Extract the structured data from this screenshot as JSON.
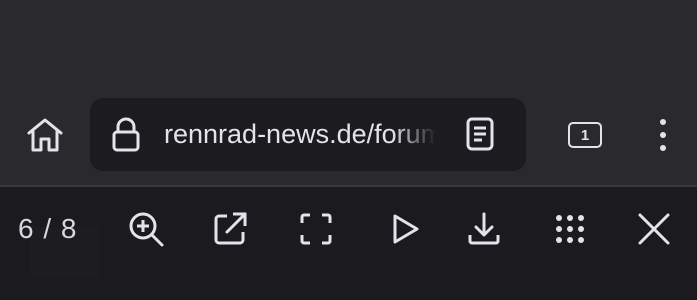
{
  "urlbar": {
    "url": "rennrad-news.de/forum",
    "lock_icon": "lock-icon",
    "reader_icon": "reader-mode-icon"
  },
  "toolbar": {
    "home_icon": "home-icon",
    "tab_count": "1",
    "menu_icon": "more-vertical-icon"
  },
  "viewer": {
    "page_counter": "6 / 8",
    "actions": [
      "zoom-in-icon",
      "share-external-icon",
      "fullscreen-icon",
      "play-icon",
      "download-icon",
      "grid-icon",
      "close-icon"
    ]
  },
  "colors": {
    "background": "#2a292e",
    "urlbar": "#1c1b20",
    "bottom_bar": "#1b1a1e",
    "foreground": "#e4e3ea"
  }
}
